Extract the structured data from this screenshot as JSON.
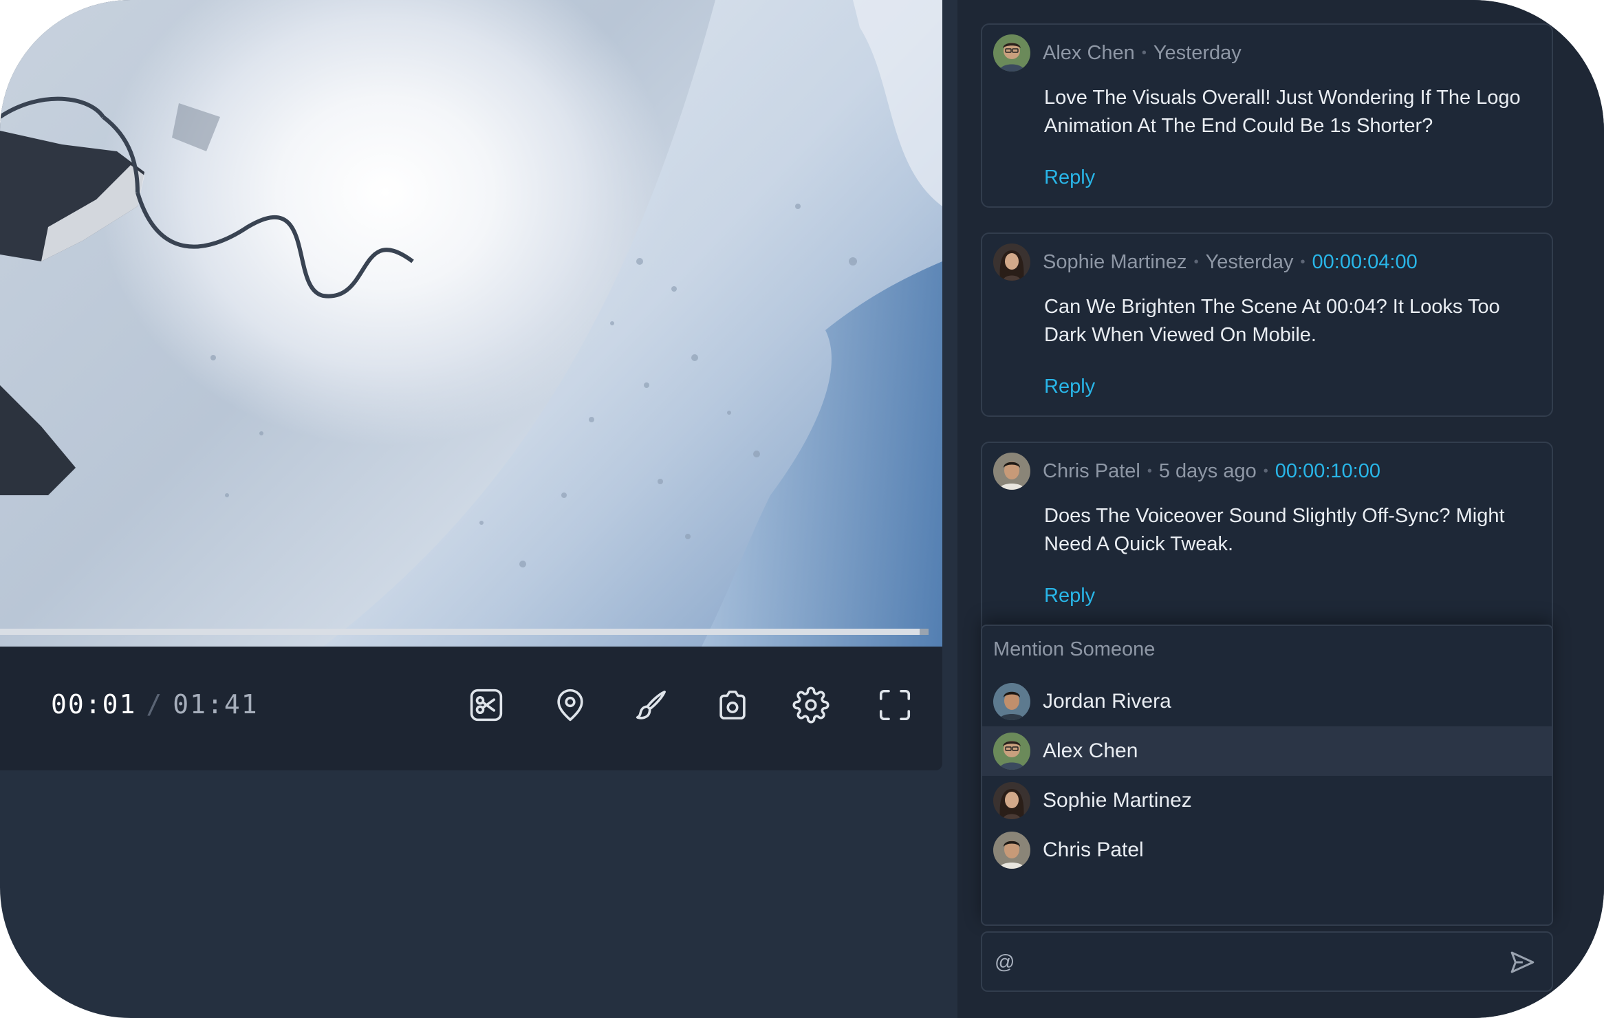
{
  "player": {
    "current_time": "00:01",
    "separator": "/",
    "total_time": "01:41",
    "progress_fraction": 0.99,
    "controls": [
      {
        "name": "trim-button",
        "icon": "scissors-icon"
      },
      {
        "name": "marker-button",
        "icon": "map-pin-icon"
      },
      {
        "name": "draw-button",
        "icon": "brush-icon"
      },
      {
        "name": "snapshot-button",
        "icon": "camera-icon"
      },
      {
        "name": "settings-button",
        "icon": "gear-icon"
      },
      {
        "name": "fullscreen-button",
        "icon": "fullscreen-icon"
      }
    ]
  },
  "comments": [
    {
      "author": "Alex Chen",
      "time": "Yesterday",
      "timestamp": "",
      "body": "Love The Visuals Overall! Just Wondering If The Logo Animation At The End Could Be 1s Shorter?",
      "reply_label": "Reply"
    },
    {
      "author": "Sophie Martinez",
      "time": "Yesterday",
      "timestamp": "00:00:04:00",
      "body": "Can We Brighten The Scene At 00:04? It Looks Too Dark When Viewed On Mobile.",
      "reply_label": "Reply"
    },
    {
      "author": "Chris Patel",
      "time": "5 days ago",
      "timestamp": "00:00:10:00",
      "body": "Does The Voiceover Sound Slightly Off-Sync? Might Need A Quick Tweak.",
      "reply_label": "Reply"
    }
  ],
  "mention": {
    "title": "Mention Someone",
    "users": [
      "Jordan Rivera",
      "Alex Chen",
      "Sophie Martinez",
      "Chris Patel"
    ],
    "highlighted": "Alex Chen"
  },
  "composer": {
    "value": "@",
    "send_icon": "send-icon"
  },
  "colors": {
    "accent": "#29b6e8",
    "panel_bg": "#1e2735",
    "card_border": "#323d4d"
  }
}
